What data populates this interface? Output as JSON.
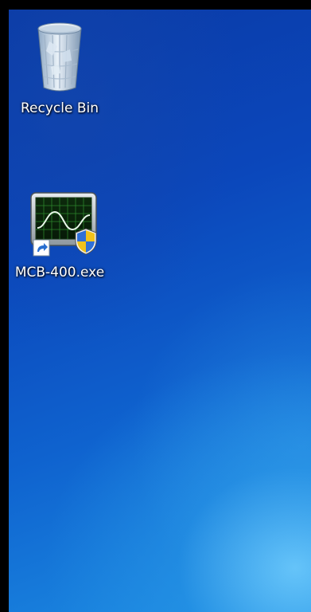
{
  "desktop": {
    "icons": [
      {
        "label": "Recycle Bin",
        "icon": "recycle-bin-icon"
      },
      {
        "label": "MCB-400.exe",
        "icon": "oscilloscope-app-icon",
        "overlays": [
          "shortcut-arrow-icon",
          "uac-shield-icon"
        ]
      }
    ]
  },
  "colors": {
    "desktop_top": "#0a3aa6",
    "desktop_bottom_glow": "#1d8fe4",
    "label_text": "#ffffff"
  }
}
